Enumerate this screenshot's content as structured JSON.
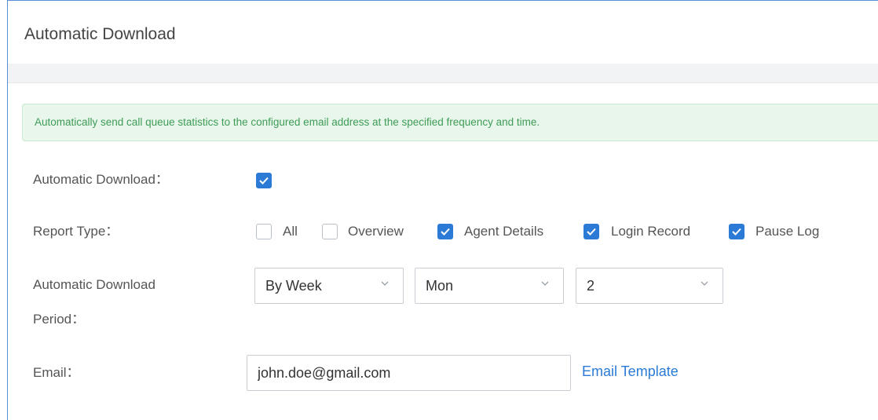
{
  "header": {
    "title": "Automatic Download"
  },
  "notice": {
    "text": "Automatically send call queue statistics to the configured email address at the specified frequency and time."
  },
  "form": {
    "auto_download": {
      "label": "Automatic Download：",
      "checked": true
    },
    "report_type": {
      "label": "Report Type：",
      "options": [
        {
          "label": "All",
          "checked": false
        },
        {
          "label": "Overview",
          "checked": false
        },
        {
          "label": "Agent Details",
          "checked": true
        },
        {
          "label": "Login Record",
          "checked": true
        },
        {
          "label": "Pause Log",
          "checked": true
        }
      ]
    },
    "period": {
      "label_line1": "Automatic Download",
      "label_line2": "Period：",
      "frequency": "By Week",
      "day": "Mon",
      "hour": "2"
    },
    "email": {
      "label": "Email：",
      "value": "john.doe@gmail.com",
      "template_link": "Email Template"
    }
  },
  "colors": {
    "accent": "#2b7bd6",
    "notice_bg": "#e9f6ec",
    "notice_text": "#3e9c56"
  }
}
